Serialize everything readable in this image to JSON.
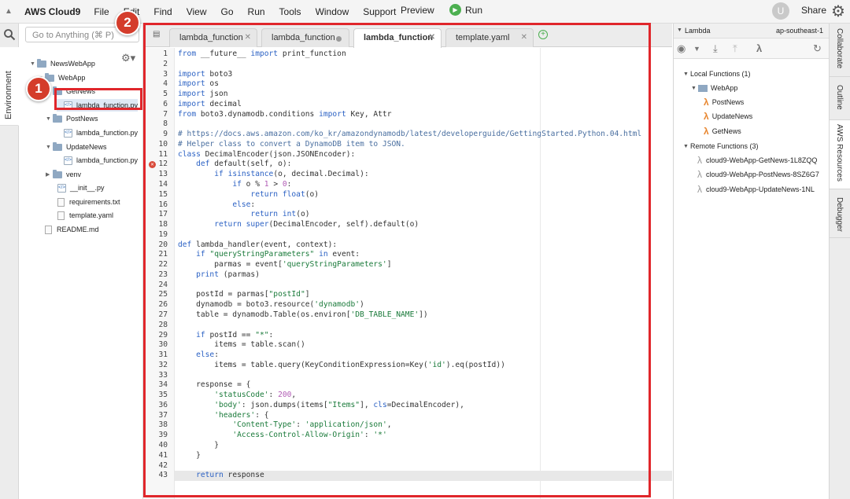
{
  "menubar": {
    "brand": "AWS Cloud9",
    "items": [
      "File",
      "Edit",
      "Find",
      "View",
      "Go",
      "Run",
      "Tools",
      "Window",
      "Support"
    ],
    "preview": "Preview",
    "run": "Run",
    "avatar_letter": "U",
    "share": "Share"
  },
  "left_tabs": {
    "environment": "Environment"
  },
  "search": {
    "placeholder": "Go to Anything (⌘ P)"
  },
  "tree": [
    {
      "label": "NewsWebApp",
      "kind": "folder",
      "tri": "▼"
    },
    {
      "label": "WebApp",
      "kind": "folder",
      "tri": "▼"
    },
    {
      "label": "GetNews",
      "kind": "folder",
      "tri": "▼"
    },
    {
      "label": "lambda_function.py",
      "kind": "py",
      "tri": ""
    },
    {
      "label": "PostNews",
      "kind": "folder",
      "tri": "▼"
    },
    {
      "label": "lambda_function.py",
      "kind": "py",
      "tri": ""
    },
    {
      "label": "UpdateNews",
      "kind": "folder",
      "tri": "▼"
    },
    {
      "label": "lambda_function.py",
      "kind": "py",
      "tri": ""
    },
    {
      "label": "venv",
      "kind": "folder",
      "tri": "▶"
    },
    {
      "label": "__init__.py",
      "kind": "py",
      "tri": ""
    },
    {
      "label": "requirements.txt",
      "kind": "doc",
      "tri": ""
    },
    {
      "label": "template.yaml",
      "kind": "doc",
      "tri": ""
    },
    {
      "label": "README.md",
      "kind": "doc",
      "tri": ""
    }
  ],
  "annotations": {
    "one": "1",
    "two": "2"
  },
  "tabs": [
    {
      "label": "lambda_function",
      "state": "close"
    },
    {
      "label": "lambda_function",
      "state": "modified"
    },
    {
      "label": "lambda_function",
      "state": "active"
    },
    {
      "label": "template.yaml",
      "state": "close"
    }
  ],
  "code_lines": [
    "from __future__ import print_function",
    "",
    "import boto3",
    "import os",
    "import json",
    "import decimal",
    "from boto3.dynamodb.conditions import Key, Attr",
    "",
    "# https://docs.aws.amazon.com/ko_kr/amazondynamodb/latest/developerguide/GettingStarted.Python.04.html",
    "# Helper class to convert a DynamoDB item to JSON.",
    "class DecimalEncoder(json.JSONEncoder):",
    "    def default(self, o):",
    "        if isinstance(o, decimal.Decimal):",
    "            if o % 1 > 0:",
    "                return float(o)",
    "            else:",
    "                return int(o)",
    "        return super(DecimalEncoder, self).default(o)",
    "",
    "def lambda_handler(event, context):",
    "    if \"queryStringParameters\" in event:",
    "        parmas = event['queryStringParameters']",
    "    print (parmas)",
    "",
    "    postId = parmas[\"postId\"]",
    "    dynamodb = boto3.resource('dynamodb')",
    "    table = dynamodb.Table(os.environ['DB_TABLE_NAME'])",
    "",
    "    if postId == \"*\":",
    "        items = table.scan()",
    "    else:",
    "        items = table.query(KeyConditionExpression=Key('id').eq(postId))",
    "",
    "    response = {",
    "        'statusCode': 200,",
    "        'body': json.dumps(items[\"Items\"], cls=DecimalEncoder),",
    "        'headers': {",
    "            'Content-Type': 'application/json',",
    "            'Access-Control-Allow-Origin': '*'",
    "        }",
    "    }",
    "",
    "    return response"
  ],
  "error_line": 12,
  "current_line": 43,
  "lambda_panel": {
    "title": "Lambda",
    "region": "ap-southeast-1",
    "local_header": "Local Functions (1)",
    "app": "WebApp",
    "local_functions": [
      "PostNews",
      "UpdateNews",
      "GetNews"
    ],
    "remote_header": "Remote Functions (3)",
    "remote_functions": [
      "cloud9-WebApp-GetNews-1L8ZQQ",
      "cloud9-WebApp-PostNews-8SZ6G7",
      "cloud9-WebApp-UpdateNews-1NL"
    ]
  },
  "right_tabs": [
    "Collaborate",
    "Outline",
    "AWS Resources",
    "Debugger"
  ],
  "colors": {
    "annotation_red": "#e0262b",
    "lambda_orange": "#e8862f",
    "run_green": "#4caf50"
  }
}
